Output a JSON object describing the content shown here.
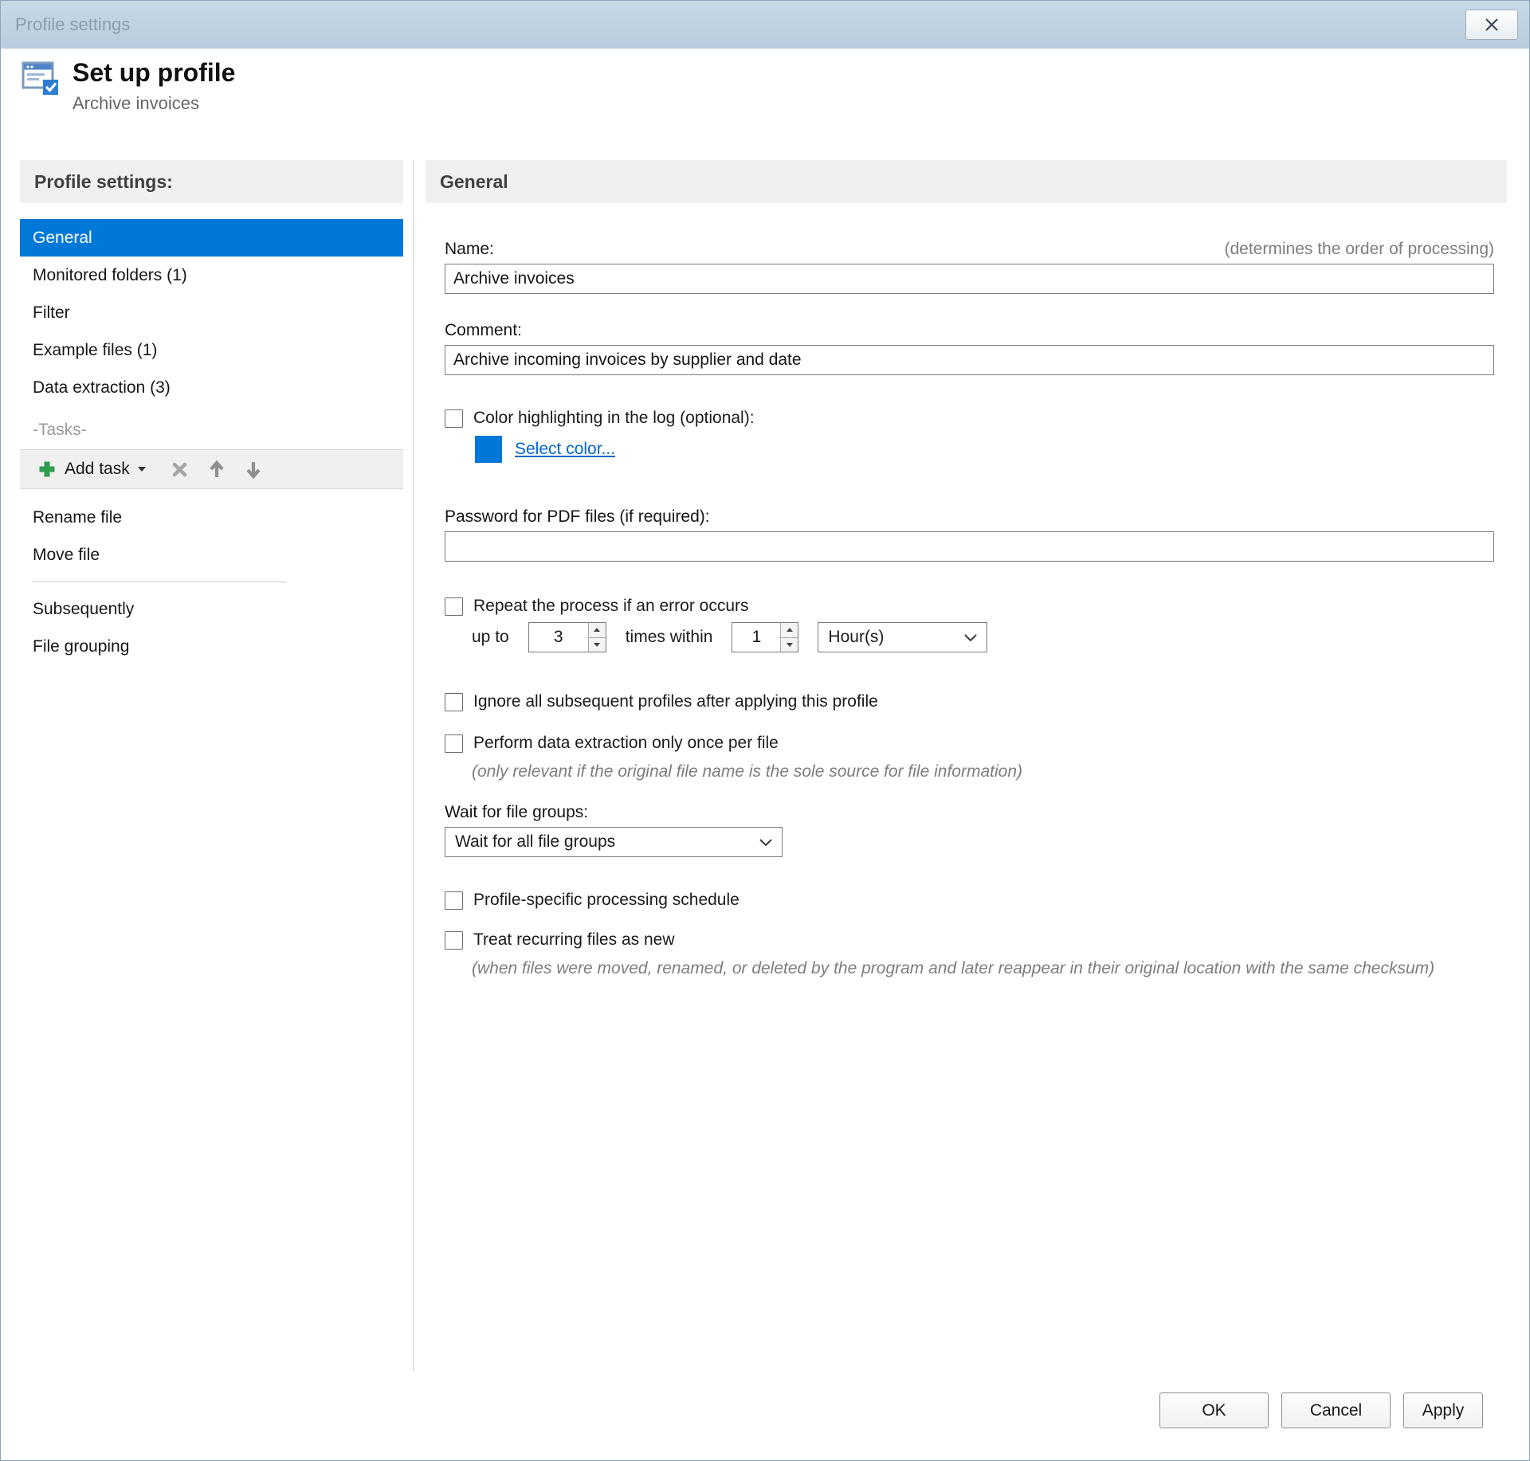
{
  "colors": {
    "accent": "#0078d7",
    "swatch": "#0078d7",
    "link": "#0066cc",
    "titlebar": "#bfd2e2",
    "selected_item_bg": "#0078d7"
  },
  "window": {
    "title": "Profile settings"
  },
  "header": {
    "title": "Set up profile",
    "subtitle": "Archive invoices"
  },
  "sidebar": {
    "header": "Profile settings:",
    "items": [
      {
        "label": "General",
        "selected": true
      },
      {
        "label": "Monitored folders (1)",
        "selected": false
      },
      {
        "label": "Filter",
        "selected": false
      },
      {
        "label": "Example files (1)",
        "selected": false
      },
      {
        "label": "Data extraction (3)",
        "selected": false
      }
    ],
    "tasks_separator": "-Tasks-",
    "toolbar": {
      "add_task_label": "Add task"
    },
    "task_items": [
      {
        "label": "Rename file"
      },
      {
        "label": "Move file"
      }
    ],
    "bottom_items": [
      {
        "label": "Subsequently"
      },
      {
        "label": "File grouping"
      }
    ]
  },
  "main": {
    "section_title": "General",
    "name": {
      "label": "Name:",
      "hint": "(determines the order of processing)",
      "value": "Archive invoices"
    },
    "comment": {
      "label": "Comment:",
      "value": "Archive incoming invoices by supplier and date"
    },
    "color": {
      "checkbox_label": "Color highlighting in the log (optional):",
      "link_label": "Select color..."
    },
    "password": {
      "label": "Password for PDF files (if required):",
      "value": ""
    },
    "repeat": {
      "checkbox_label": "Repeat the process if an error occurs",
      "prefix": "up to",
      "times_value": "3",
      "middle": "times within",
      "within_value": "1",
      "unit": "Hour(s)"
    },
    "ignore": {
      "checkbox_label": "Ignore all subsequent profiles after applying this profile"
    },
    "extract": {
      "checkbox_label": "Perform data extraction only once per file",
      "hint": "(only relevant if the original file name is the sole source for file information)"
    },
    "wait": {
      "label": "Wait for file groups:",
      "value": "Wait for all file groups"
    },
    "schedule": {
      "checkbox_label": "Profile-specific processing schedule"
    },
    "recurring": {
      "checkbox_label": "Treat recurring files as new",
      "hint": "(when files were moved, renamed, or deleted by the program and later reappear in their original location with the same checksum)"
    }
  },
  "footer": {
    "ok_label": "OK",
    "cancel_label": "Cancel",
    "apply_label": "Apply"
  }
}
